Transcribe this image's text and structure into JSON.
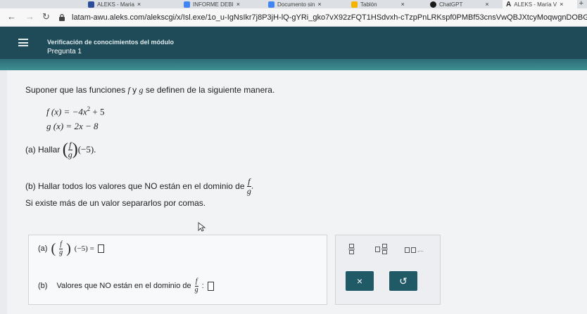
{
  "browser": {
    "tabs": [
      {
        "label": "ALEKS - Maria",
        "color": "#2b4d9a"
      },
      {
        "label": "INFORME DEBI",
        "color": "#4285f4"
      },
      {
        "label": "Documento sin",
        "color": "#4285f4"
      },
      {
        "label": "Tablón",
        "color": "#f4b400"
      },
      {
        "label": "ChatGPT",
        "color": "#1a1a1a"
      },
      {
        "label": "ALEKS - María V",
        "color": "#222222"
      }
    ],
    "url": "latam-awu.aleks.com/alekscgi/x/Isl.exe/1o_u-IgNsIkr7j8P3jH-lQ-gYRi_gko7vX92zFQT1HSdvxh-cTzpPnLRKspf0PMBf53cnsVwQBJXtcyMoqwgnDOBG5a..."
  },
  "header": {
    "module_title": "Verificación de conocimientos del módulo",
    "question": "Pregunta 1"
  },
  "problem": {
    "prompt_pre": "Suponer que las funciones",
    "prompt_f": "f",
    "prompt_and": "y",
    "prompt_g": "g",
    "prompt_post": "se definen de la siguiente manera.",
    "f_def": "f (x) = −4x",
    "f_exp": "2",
    "f_tail": " + 5",
    "g_def": "g (x) = 2x − 8",
    "part_a_label": "(a) Hallar",
    "part_a_arg": "(−5).",
    "part_b_text": "(b) Hallar todos los valores que NO están en el dominio de",
    "part_b_end": ".",
    "note": "Si existe más de un valor separarlos por comas.",
    "frac_num": "f",
    "frac_den": "g"
  },
  "answer": {
    "a_label": "(a)",
    "a_arg": "(−5) =",
    "b_label": "(b)",
    "b_text": "Valores que NO están en el dominio de",
    "b_colon": ":"
  },
  "tools": {
    "clear_label": "×",
    "undo_label": "↺"
  }
}
